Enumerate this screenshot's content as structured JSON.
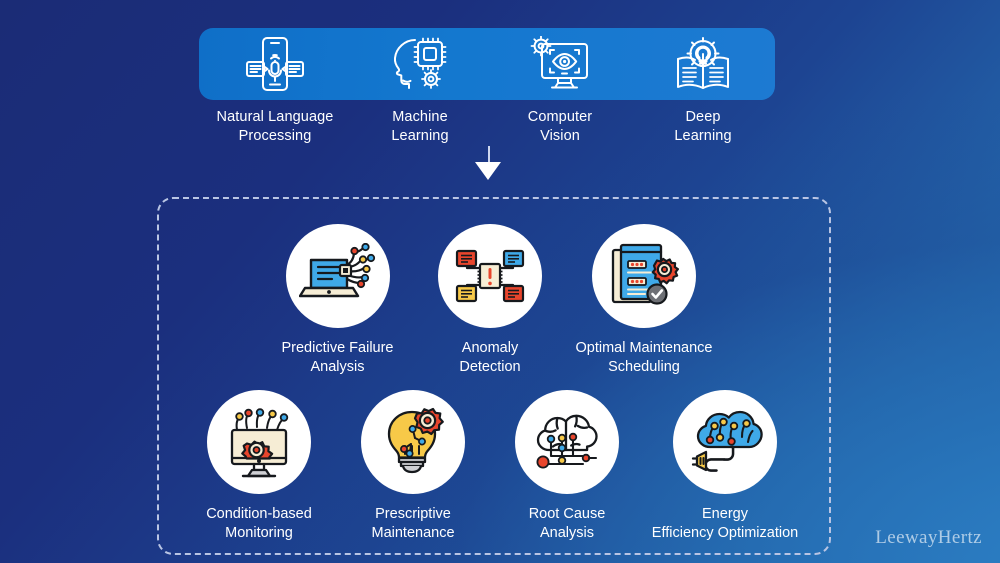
{
  "background": {
    "gradient_from": "#1b2c76",
    "gradient_to": "#2a79bf",
    "watermark": "LeewayHertz"
  },
  "banner": {
    "background_color": "#1478cf",
    "items": [
      {
        "icon": "smartphone-voice-chat-icon",
        "label": "Natural Language\nProcessing",
        "label_line1": "Natural Language",
        "label_line2": "Processing"
      },
      {
        "icon": "head-cpu-gear-icon",
        "label": "Machine\nLearning",
        "label_line1": "Machine",
        "label_line2": "Learning"
      },
      {
        "icon": "monitor-eye-gear-icon",
        "label": "Computer\nVision",
        "label_line1": "Computer",
        "label_line2": "Vision"
      },
      {
        "icon": "book-lightbulb-gear-icon",
        "label": "Deep\nLearning",
        "label_line1": "Deep",
        "label_line2": "Learning"
      }
    ]
  },
  "connector": {
    "arrow_icon": "down-arrow-icon",
    "color": "#ffffff"
  },
  "panel": {
    "border_style": "dashed",
    "border_color": "#b9c5e4",
    "row1": [
      {
        "icon": "laptop-neural-network-icon",
        "label_line1": "Predictive Failure",
        "label_line2": "Analysis"
      },
      {
        "icon": "chip-alert-network-icon",
        "label_line1": "Anomaly",
        "label_line2": "Detection"
      },
      {
        "icon": "clipboard-gear-check-icon",
        "label_line1": "Optimal Maintenance",
        "label_line2": "Scheduling"
      }
    ],
    "row2": [
      {
        "icon": "monitor-gear-sensors-icon",
        "label_line1": "Condition-based",
        "label_line2": "Monitoring"
      },
      {
        "icon": "lightbulb-gear-circuit-icon",
        "label_line1": "Prescriptive",
        "label_line2": "Maintenance"
      },
      {
        "icon": "cloud-brain-circuit-icon",
        "label_line1": "Root Cause",
        "label_line2": "Analysis"
      },
      {
        "icon": "cloud-plug-energy-icon",
        "label_line1": "Energy",
        "label_line2": "Efficiency Optimization"
      }
    ]
  },
  "palette": {
    "red": "#e8452c",
    "yellow": "#f7c948",
    "blue": "#3fa9e8",
    "cream": "#f6edd5",
    "dark": "#1a1a1a",
    "gray": "#6e7075",
    "white": "#ffffff"
  }
}
